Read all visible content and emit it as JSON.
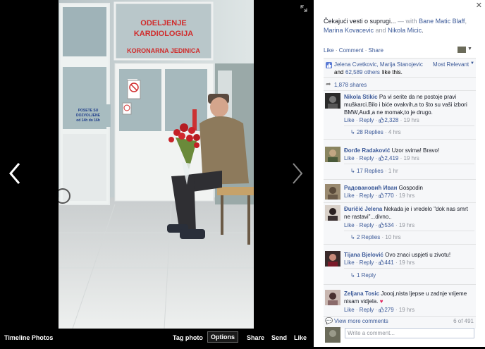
{
  "viewer": {
    "bottom_left": "Timeline Photos",
    "tag_photo": "Tag photo",
    "options": "Options",
    "share": "Share",
    "send": "Send",
    "like": "Like",
    "photo_signs": {
      "dept1": "ODELJENJE",
      "dept2": "KARDIOLOGIJA",
      "dept3": "KORONARNA JEDINICA",
      "notice1": "POSETE SU",
      "notice2": "DOZVOLJENE",
      "notice3": "od 14h do 16h"
    }
  },
  "post": {
    "text": "Čekajući vesti o suprugi...",
    "with": " — with ",
    "tag1": "Bane Matic Blaff",
    "tag_sep": ",",
    "tag2": "Marina Kovacevic",
    "and": " and ",
    "tag3": "Nikola Micic",
    "period": ".",
    "like": "Like",
    "comment": "Comment",
    "share": "Share",
    "sep": " · "
  },
  "likes": {
    "names": "Jelena Cvetkovic, Marija Stanojevic",
    "and": "and",
    "others": "62,589 others",
    "suffix": "like this.",
    "sort": "Most Relevant",
    "shares": "1,878 shares"
  },
  "comments": [
    {
      "name": "Nikola Stikic",
      "text": "Pa vi serite da ne postoje pravi muškarci.Bilo i biće ovakvih,a to što su vaši izbori BMW,Audi,a ne momak,to je drugo.",
      "likes": "2,328",
      "time": "19 hrs",
      "replies": "28 Replies",
      "replies_time": "4 hrs"
    },
    {
      "name": "Đorđe Radaković",
      "text": "Uzor svima! Bravo!",
      "likes": "2,419",
      "time": "19 hrs",
      "replies": "17 Replies",
      "replies_time": "1 hr"
    },
    {
      "name": "Радовановић Иван",
      "text": "Gospodin",
      "likes": "770",
      "time": "19 hrs"
    },
    {
      "name": "Đuričić Jelena",
      "text": "Nekada je i vredelo \"dok nas smrt ne rastavi\"...divno..",
      "likes": "534",
      "time": "19 hrs",
      "replies": "2 Replies",
      "replies_time": "10 hrs"
    },
    {
      "name": "Tijana Bjelović",
      "text": "Ovo znaci uspjeti u zivotu!",
      "likes": "441",
      "time": "19 hrs",
      "replies": "1 Reply",
      "replies_time": ""
    },
    {
      "name": "Zeljana Tosic",
      "text": "Joooj,nista ljepse u zadnje vrijeme nisam vidjela.",
      "likes": "279",
      "time": "19 hrs"
    }
  ],
  "comment_actions": {
    "like": "Like",
    "reply": "Reply",
    "sep": " · "
  },
  "more": {
    "label": "View more comments",
    "count": "6 of 491"
  },
  "input": {
    "placeholder": "Write a comment..."
  },
  "colors": {
    "link": "#3b5998",
    "bg": "#f6f7f9",
    "heart": "#e0245e"
  }
}
